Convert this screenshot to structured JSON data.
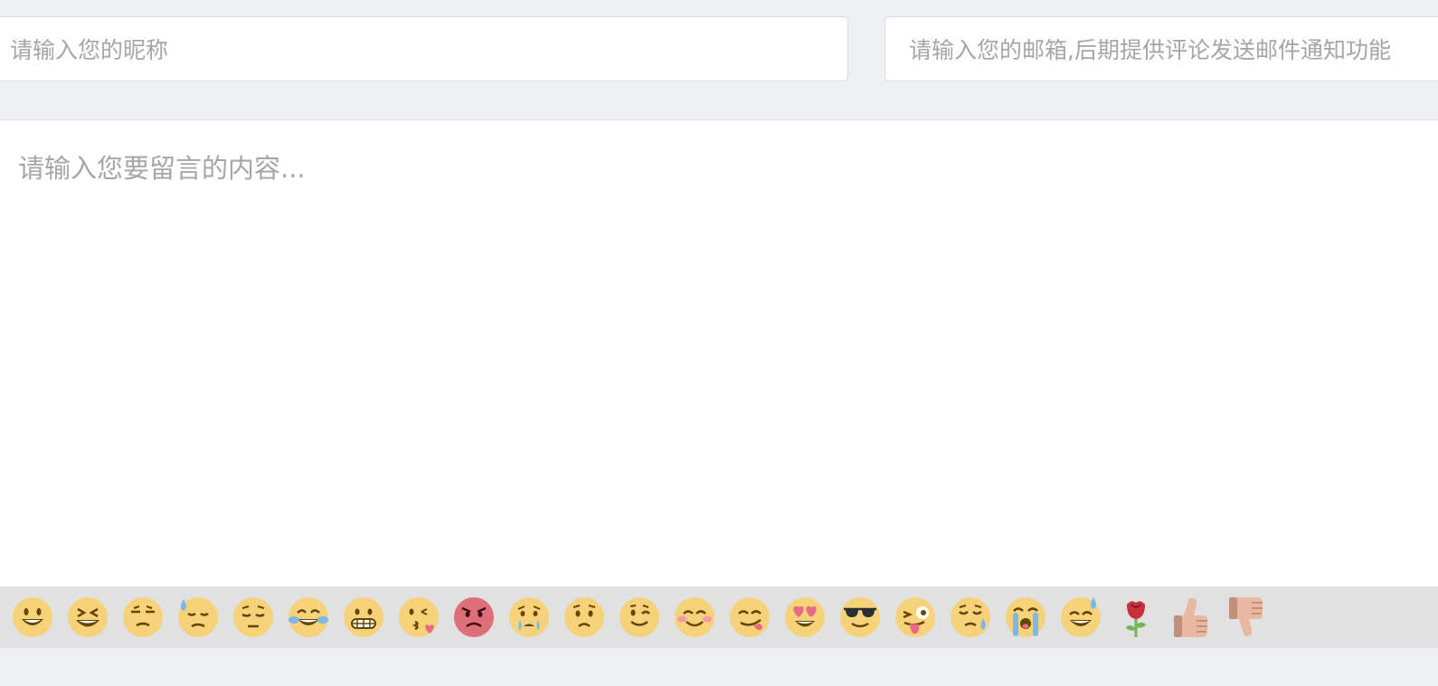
{
  "form": {
    "nickname": {
      "placeholder": "请输入您的昵称"
    },
    "email": {
      "placeholder": "请输入您的邮箱,后期提供评论发送邮件通知功能"
    },
    "content": {
      "placeholder": "请输入您要留言的内容..."
    }
  },
  "emoji_bar": {
    "items": [
      "smile",
      "laughing",
      "unamused",
      "sweat",
      "pensive",
      "joy",
      "grimacing",
      "kissing-heart",
      "angry",
      "cry",
      "worried",
      "wink",
      "blush",
      "yum",
      "heart-eyes",
      "sunglasses",
      "stuck-out-tongue-winking-eye",
      "disappointed-relieved",
      "sob",
      "sweat-smile",
      "rose",
      "thumbs-up",
      "thumbs-down"
    ]
  },
  "colors": {
    "background": "#eff0f4",
    "placeholder": "#a6a6a6",
    "emoji_face": "#f6d27a",
    "emoji_angry": "#de6e78",
    "emoji_tear": "#7ab8e8"
  }
}
